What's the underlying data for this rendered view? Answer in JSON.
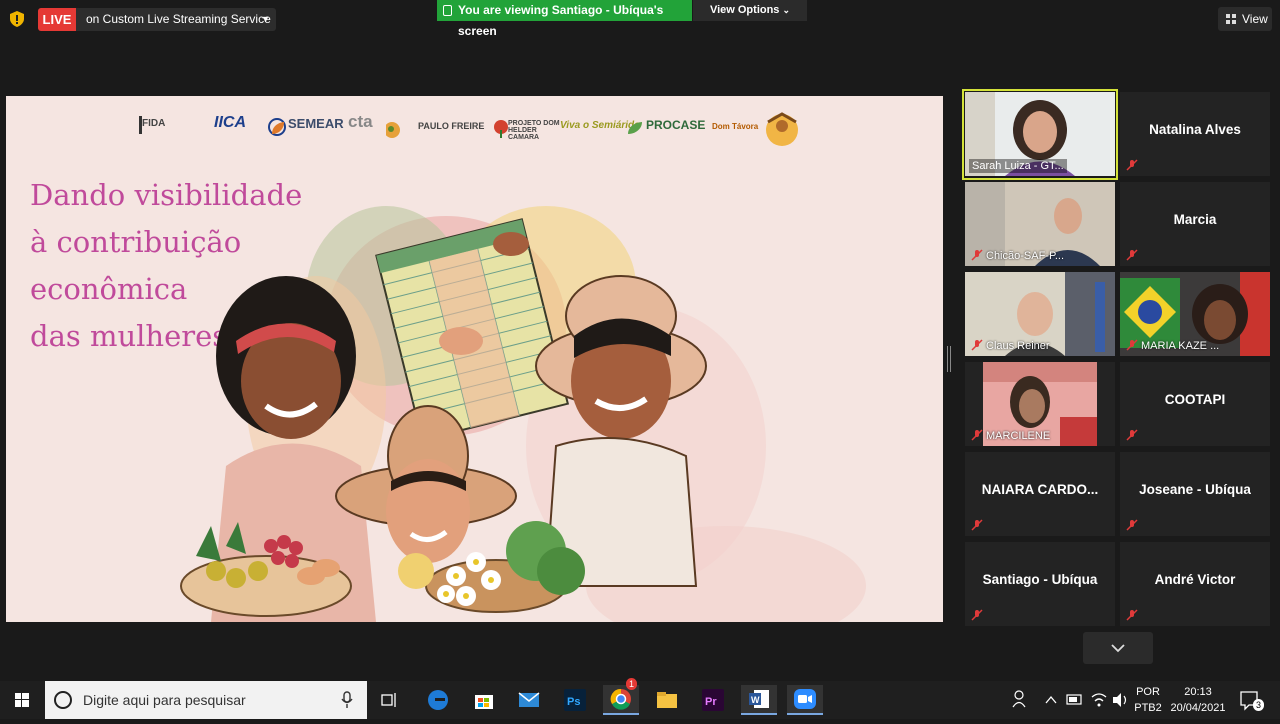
{
  "top_bar": {
    "live_label": "LIVE",
    "stream_service": "on Custom Live Streaming Service",
    "viewing_text": "You are viewing Santiago - Ubíqua's screen",
    "view_options_label": "View Options",
    "view_label": "View",
    "viewing_bar_color": "#22a339",
    "live_color": "#e53935"
  },
  "slide": {
    "logos": [
      "FIDA",
      "IICA",
      "SEMEAR",
      "cta",
      "PAULO FREIRE",
      "PROJETO DOM HELDER CAMARA",
      "Viva o Semiárido",
      "PROCASE",
      "Dom Távora",
      ""
    ],
    "title_lines": [
      "Dando visibilidade",
      "à contribuição",
      "econômica",
      "das mulheres"
    ],
    "title_color": "#c04a9b"
  },
  "participants": [
    {
      "name": "Sarah Luiza - GT...",
      "video": true,
      "speaking": true,
      "muted": false
    },
    {
      "name": "Natalina Alves",
      "video": false,
      "muted": true
    },
    {
      "name": "Chicão-SAF-P...",
      "video": true,
      "muted": true
    },
    {
      "name": "Marcia",
      "video": false,
      "muted": true
    },
    {
      "name": "Claus Reiner",
      "video": true,
      "muted": true
    },
    {
      "name": "MARIA KAZE ...",
      "video": true,
      "muted": true
    },
    {
      "name": "MARCILENE",
      "video": true,
      "muted": true
    },
    {
      "name": "COOTAPI",
      "video": false,
      "muted": true
    },
    {
      "name": "NAIARA CARDO...",
      "video": false,
      "muted": true
    },
    {
      "name": "Joseane - Ubíqua",
      "video": false,
      "muted": true
    },
    {
      "name": "Santiago - Ubíqua",
      "video": false,
      "muted": true
    },
    {
      "name": "André Victor",
      "video": false,
      "muted": true
    }
  ],
  "taskbar": {
    "search_placeholder": "Digite aqui para pesquisar",
    "language": "POR",
    "layout": "PTB2",
    "time": "20:13",
    "date": "20/04/2021",
    "notification_count": "3",
    "chrome_badge": "1",
    "apps": [
      "task-view",
      "edge",
      "store",
      "mail",
      "photoshop",
      "chrome",
      "file-explorer",
      "premiere",
      "word",
      "zoom"
    ]
  }
}
